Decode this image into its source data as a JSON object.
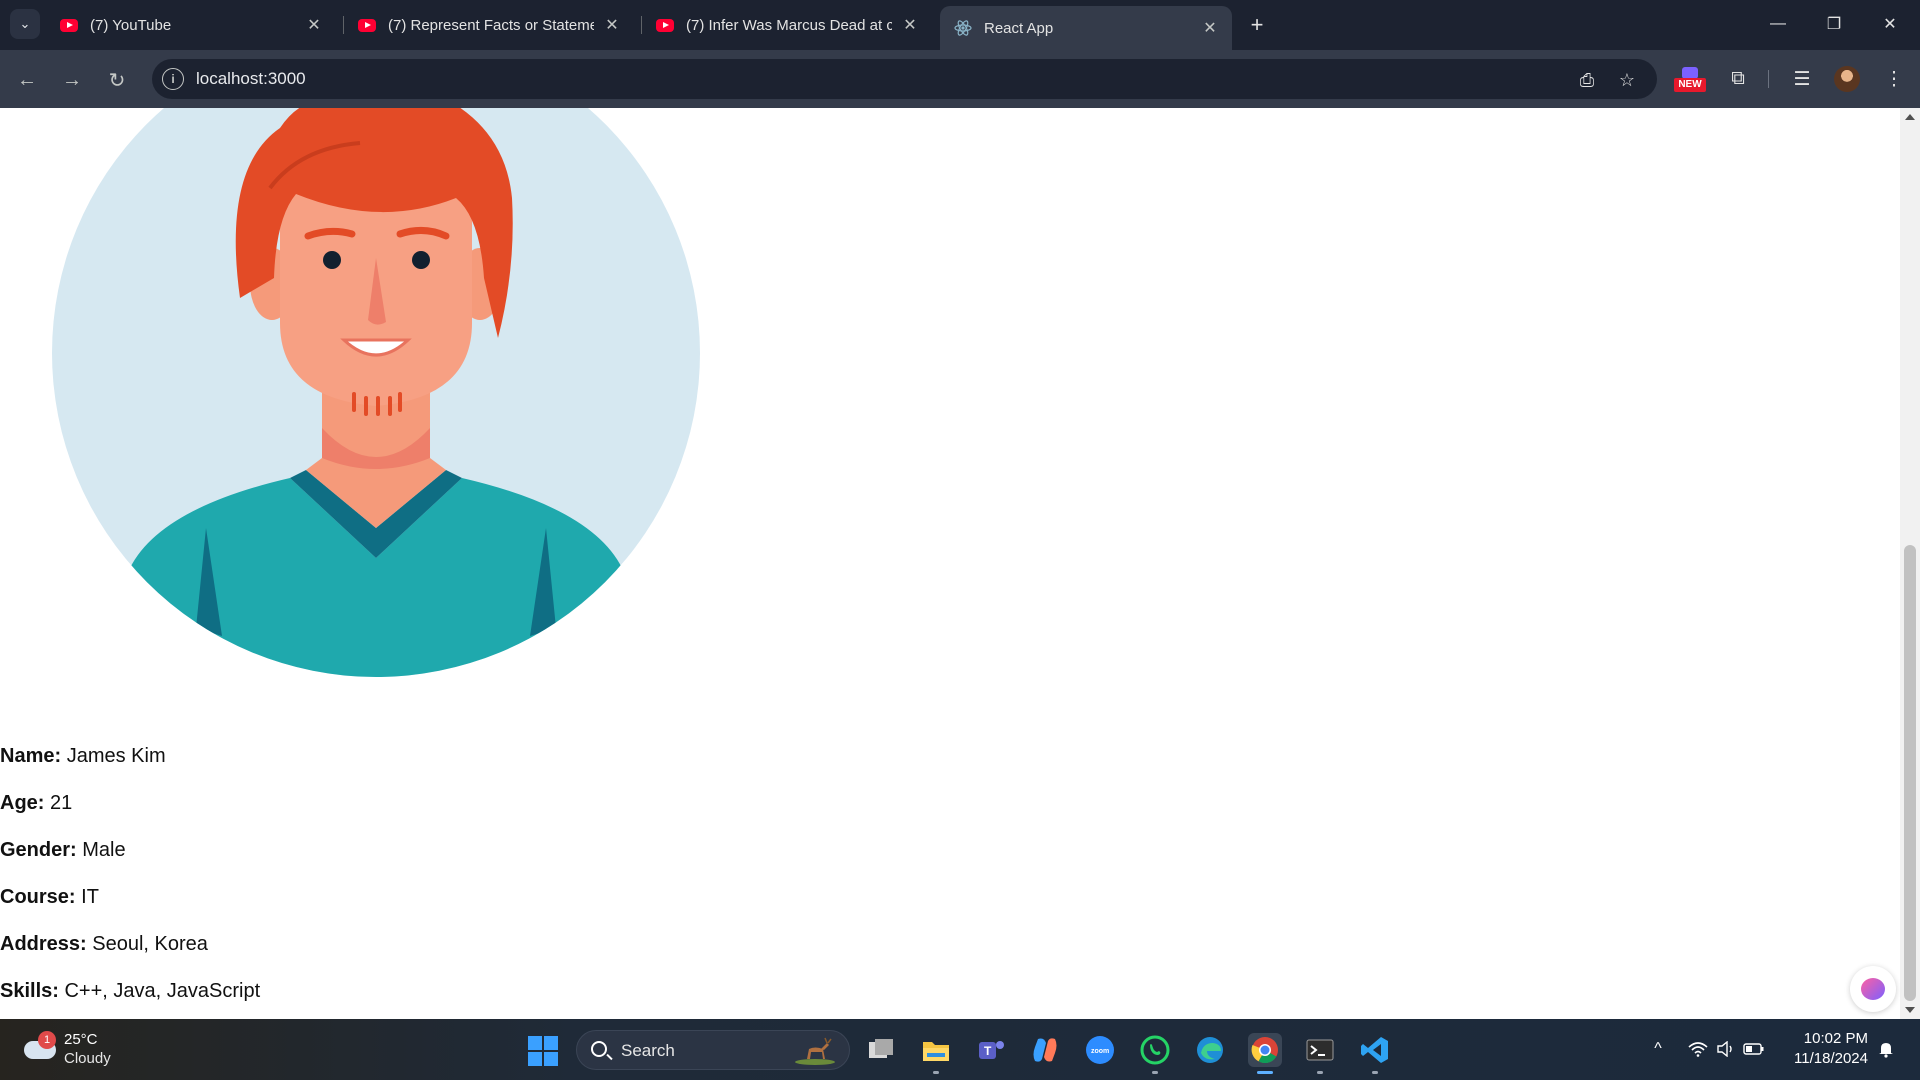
{
  "browser": {
    "tabs": [
      {
        "title": "(7) YouTube",
        "favicon": "youtube-icon",
        "active": false
      },
      {
        "title": "(7) Represent Facts or Statemen",
        "favicon": "youtube-icon",
        "active": false
      },
      {
        "title": "(7) Infer Was Marcus Dead at cu",
        "favicon": "youtube-icon",
        "active": false
      },
      {
        "title": "React App",
        "favicon": "react-icon",
        "active": true
      }
    ],
    "address": "localhost:3000",
    "extension_badge": "NEW"
  },
  "profile": {
    "fields": [
      {
        "label": "Name:",
        "value": "James Kim"
      },
      {
        "label": "Age:",
        "value": "21"
      },
      {
        "label": "Gender:",
        "value": "Male"
      },
      {
        "label": "Course:",
        "value": "IT"
      },
      {
        "label": "Address:",
        "value": "Seoul, Korea"
      },
      {
        "label": "Skills:",
        "value": "C++, Java, JavaScript"
      }
    ]
  },
  "taskbar": {
    "weather": {
      "temp": "25°C",
      "condition": "Cloudy",
      "badge": "1"
    },
    "search_label": "Search",
    "apps": [
      "task-view",
      "file-explorer",
      "teams",
      "copilot",
      "zoom",
      "whatsapp",
      "edge",
      "chrome",
      "terminal",
      "vscode"
    ],
    "clock": {
      "time": "10:02 PM",
      "date": "11/18/2024"
    }
  },
  "colors": {
    "tab_bar": "#1c2230",
    "toolbar": "#343b4a",
    "avatar_bg": "#d6e8f1",
    "hair": "#e34b26",
    "skin": "#f59a7a",
    "shirt": "#1fa9ad"
  }
}
